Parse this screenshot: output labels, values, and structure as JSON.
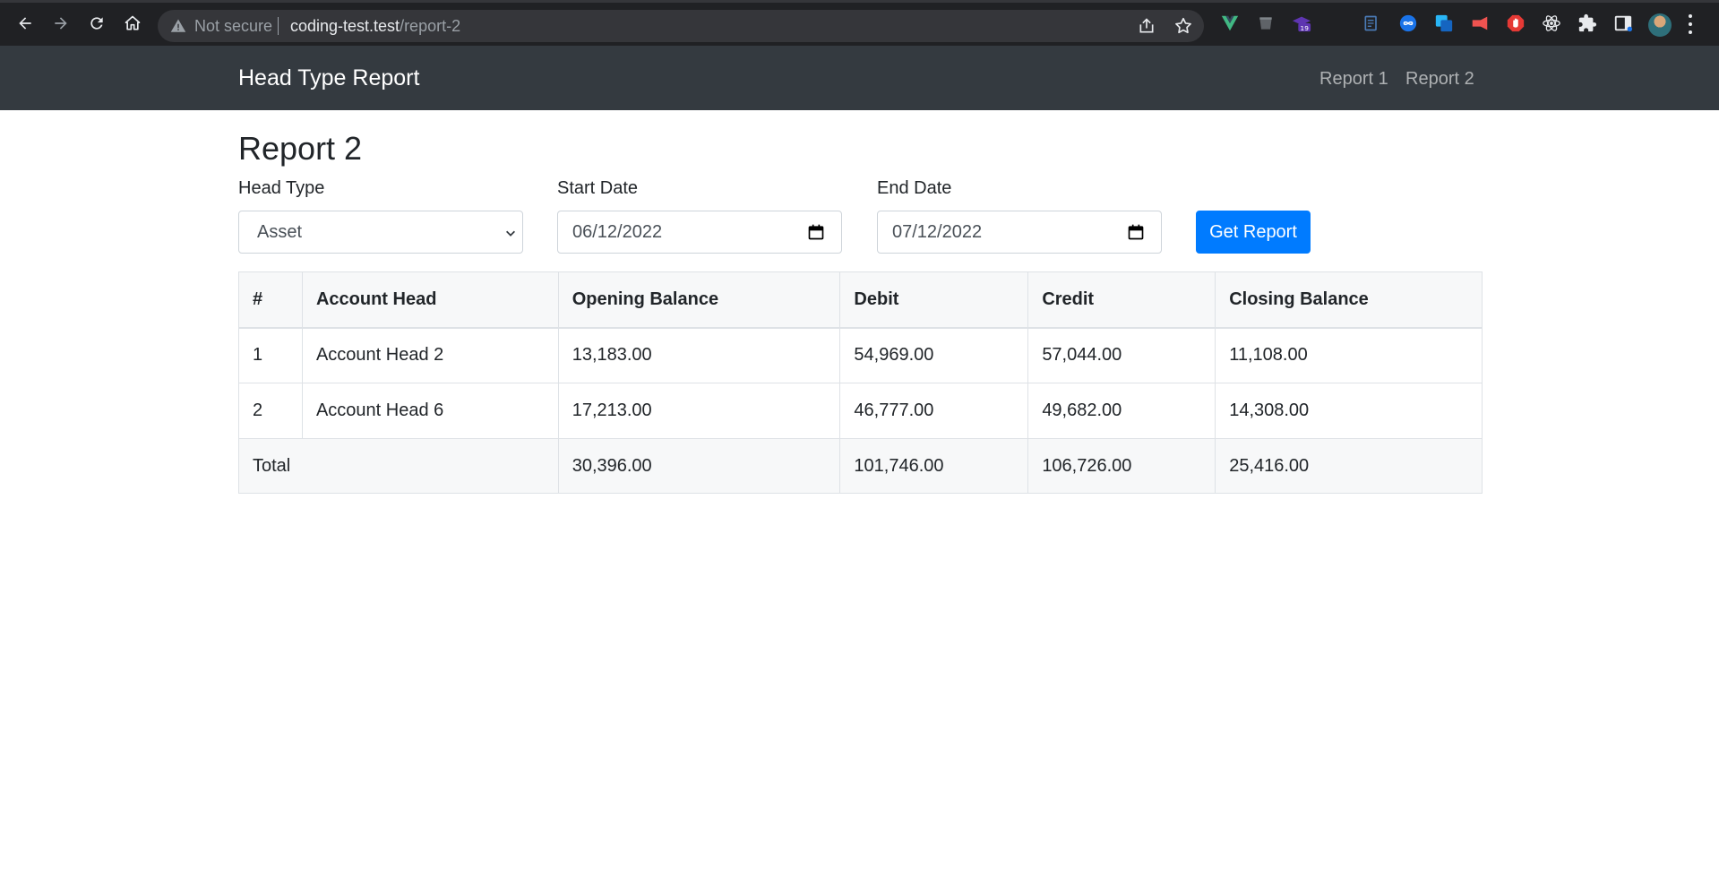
{
  "browser": {
    "security_label": "Not secure",
    "url_host": "coding-test.test",
    "url_path": "/report-2",
    "extension_badge": "19"
  },
  "navbar": {
    "brand": "Head Type Report",
    "links": [
      "Report 1",
      "Report 2"
    ]
  },
  "page": {
    "title": "Report 2"
  },
  "form": {
    "head_type_label": "Head Type",
    "head_type_value": "Asset",
    "start_date_label": "Start Date",
    "start_date_value": "06/12/2022",
    "end_date_label": "End Date",
    "end_date_value": "07/12/2022",
    "submit_label": "Get Report"
  },
  "table": {
    "headers": [
      "#",
      "Account Head",
      "Opening Balance",
      "Debit",
      "Credit",
      "Closing Balance"
    ],
    "rows": [
      [
        "1",
        "Account Head 2",
        "13,183.00",
        "54,969.00",
        "57,044.00",
        "11,108.00"
      ],
      [
        "2",
        "Account Head 6",
        "17,213.00",
        "46,777.00",
        "49,682.00",
        "14,308.00"
      ]
    ],
    "total": {
      "label": "Total",
      "opening": "30,396.00",
      "debit": "101,746.00",
      "credit": "106,726.00",
      "closing": "25,416.00"
    }
  },
  "colors": {
    "navbar_bg": "#343a40",
    "primary": "#007bff",
    "browser_bg": "#202124"
  }
}
